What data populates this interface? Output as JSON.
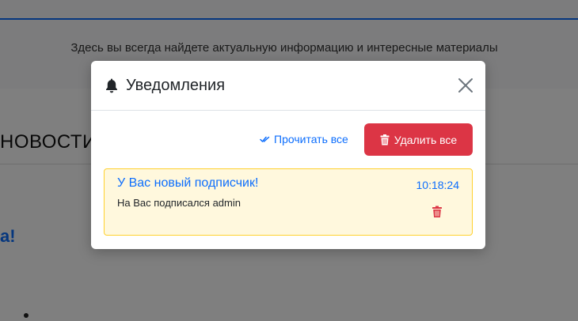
{
  "background": {
    "subtitle": "Здесь вы всегда найдете актуальную информацию и интересные материалы",
    "section_heading": "НОВОСТИ",
    "highlight_text": "а!"
  },
  "modal": {
    "title": "Уведомления",
    "title_icon": "bell-icon",
    "close_icon": "close-icon",
    "read_all_label": "Прочитать все",
    "delete_all_label": "Удалить все",
    "notifications": [
      {
        "title": "У Вас новый подписчик!",
        "time": "10:18:24",
        "body": "На Вас подписался admin"
      }
    ]
  },
  "colors": {
    "accent": "#0d6efd",
    "danger": "#dc3545",
    "notification_bg": "#fff8dd",
    "notification_border": "#ffd12e"
  }
}
